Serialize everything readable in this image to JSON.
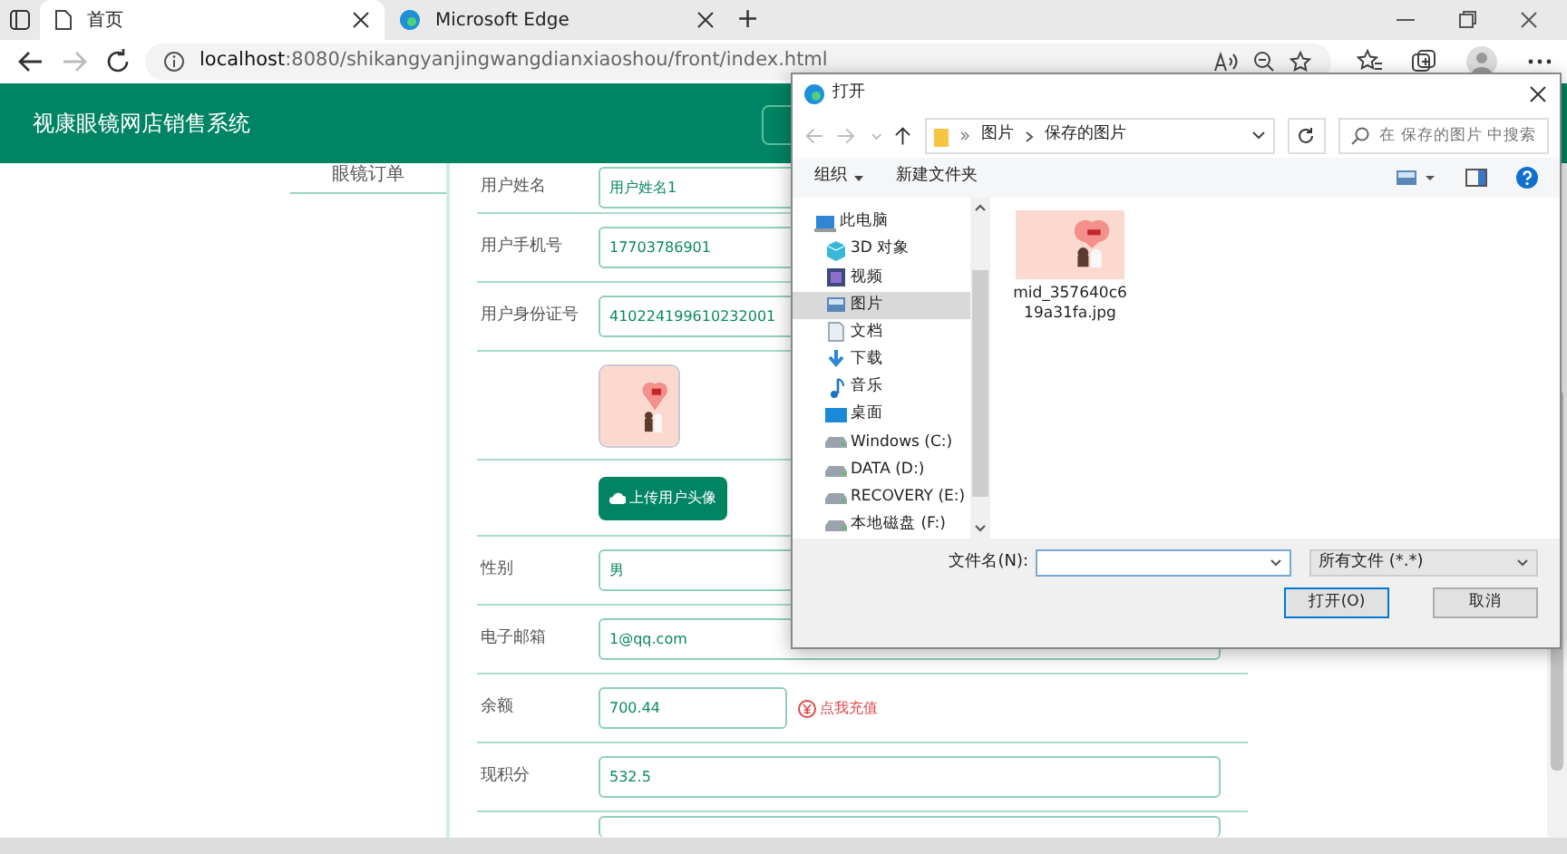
{
  "browser": {
    "tabs": [
      {
        "title": "首页",
        "kind": "page",
        "selected": true
      },
      {
        "title": "Microsoft Edge",
        "kind": "edge",
        "selected": false
      }
    ],
    "new_tab": "+",
    "address_host": "localhost",
    "address_rest": ":8080/shikangyanjingwangdianxiaoshou/front/index.html"
  },
  "header": {
    "title": "视康眼镜网店销售系统"
  },
  "sidebar": {
    "items": [
      {
        "label": "眼镜订单"
      }
    ]
  },
  "form": {
    "rows": [
      {
        "kind": "field",
        "label": "用户姓名",
        "value": "用户姓名1"
      },
      {
        "kind": "field",
        "label": "用户手机号",
        "value": "17703786901"
      },
      {
        "kind": "field",
        "label": "用户身份证号",
        "value": "410224199610232001"
      },
      {
        "kind": "avatar"
      },
      {
        "kind": "upload",
        "button": "上传用户头像"
      },
      {
        "kind": "field",
        "label": "性别",
        "value": "男"
      },
      {
        "kind": "field",
        "label": "电子邮箱",
        "value": "1@qq.com"
      },
      {
        "kind": "balance",
        "label": "余额",
        "value": "700.44",
        "link": "点我充值"
      },
      {
        "kind": "field",
        "label": "现积分",
        "value": "532.5"
      },
      {
        "kind": "blank"
      }
    ]
  },
  "dialog": {
    "title": "打开",
    "path": [
      "图片",
      "保存的图片"
    ],
    "search_placeholder": "在 保存的图片 中搜索",
    "organize": "组织",
    "new_folder": "新建文件夹",
    "tree": [
      {
        "label": "此电脑",
        "kind": "pc",
        "selected": false,
        "children": [
          {
            "label": "3D 对象",
            "kind": "cube",
            "selected": false
          },
          {
            "label": "视频",
            "kind": "video",
            "selected": false
          },
          {
            "label": "图片",
            "kind": "pictures",
            "selected": true
          },
          {
            "label": "文档",
            "kind": "doc",
            "selected": false
          },
          {
            "label": "下载",
            "kind": "download",
            "selected": false
          },
          {
            "label": "音乐",
            "kind": "music",
            "selected": false
          },
          {
            "label": "桌面",
            "kind": "desktop",
            "selected": false
          },
          {
            "label": "Windows (C:)",
            "kind": "drive",
            "selected": false
          },
          {
            "label": "DATA (D:)",
            "kind": "drive",
            "selected": false
          },
          {
            "label": "RECOVERY (E:)",
            "kind": "drive",
            "selected": false
          },
          {
            "label": "本地磁盘 (F:)",
            "kind": "drive",
            "selected": false
          }
        ]
      }
    ],
    "files": [
      {
        "name": "mid_357640c619a31fa.jpg"
      }
    ],
    "filename_label": "文件名(N):",
    "filter": "所有文件 (*.*)",
    "open_button": "打开(O)",
    "cancel_button": "取消"
  }
}
